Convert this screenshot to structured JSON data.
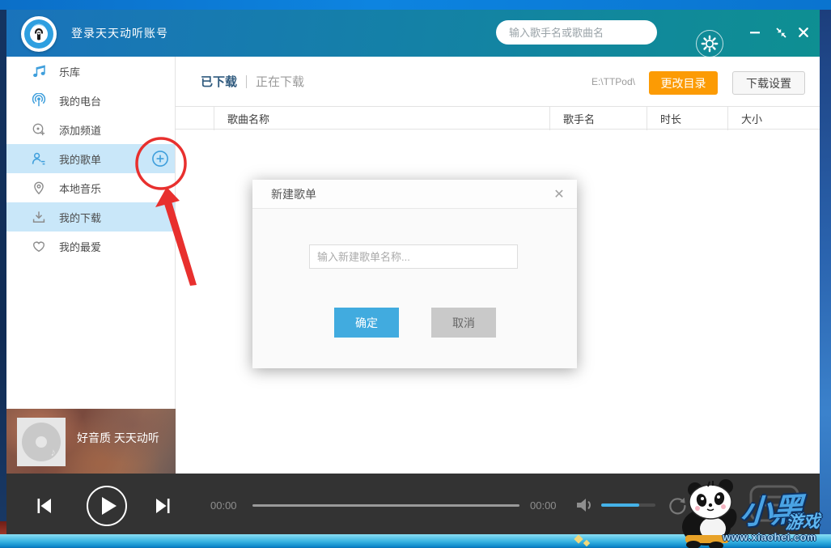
{
  "titlebar": {
    "login_label": "登录天天动听账号",
    "search_placeholder": "输入歌手名或歌曲名"
  },
  "sidebar": {
    "items": [
      {
        "label": "乐库"
      },
      {
        "label": "我的电台"
      },
      {
        "label": "添加频道"
      },
      {
        "label": "我的歌单"
      },
      {
        "label": "本地音乐"
      },
      {
        "label": "我的下载"
      },
      {
        "label": "我的最爱"
      }
    ]
  },
  "downloads": {
    "tabs": [
      {
        "label": "已下载"
      },
      {
        "label": "正在下载"
      }
    ],
    "path": "E:\\TTPod\\",
    "change_dir_label": "更改目录",
    "settings_label": "下载设置",
    "columns": [
      "歌曲名称",
      "歌手名",
      "时长",
      "大小"
    ]
  },
  "dialog": {
    "title": "新建歌单",
    "input_placeholder": "输入新建歌单名称...",
    "ok_label": "确定",
    "cancel_label": "取消",
    "close_glyph": "✕"
  },
  "now_playing": {
    "caption": "好音质 天天动听"
  },
  "player": {
    "elapsed": "00:00",
    "total": "00:00"
  },
  "watermark": {
    "site_name_main": "小黑",
    "site_name_sub": "游戏",
    "site_url": "www.xiaohei.com"
  },
  "colors": {
    "header_left": "#1a73bb",
    "header_right": "#0e8f92",
    "accent_blue": "#3f9fdc",
    "highlight_blue": "#c9e7f9",
    "accent_orange": "#fc9b04",
    "ok_blue": "#41abdf",
    "cancel_gray": "#c9c9c9",
    "tab_active": "#2f5a7e",
    "player_dark": "#333333",
    "volume_blue": "#45b2e8",
    "annotation_red": "#e8302e"
  }
}
